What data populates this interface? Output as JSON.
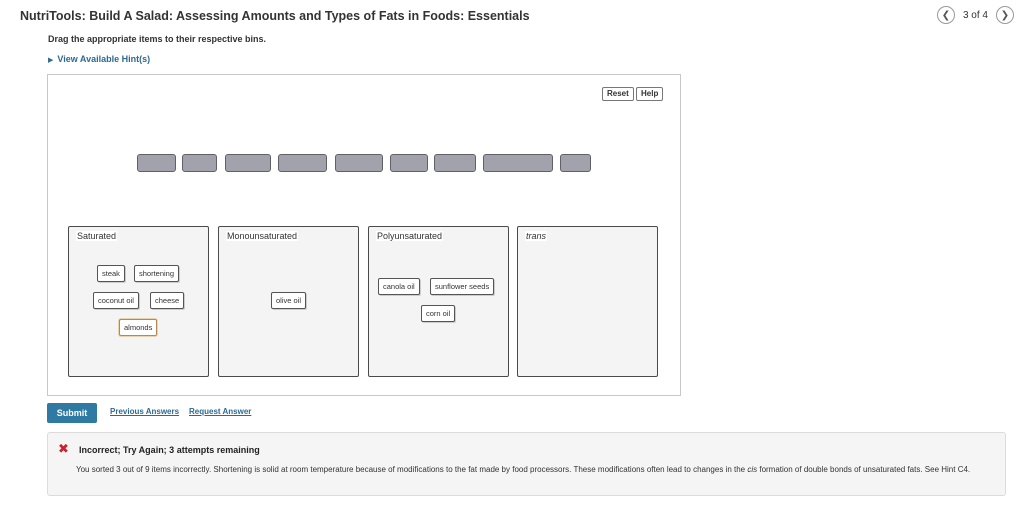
{
  "header": {
    "title": "NutriTools: Build A Salad: Assessing Amounts and Types of Fats in Foods: Essentials",
    "pager_text": "3 of 4",
    "prev_icon": "chevron-left-icon",
    "next_icon": "chevron-right-icon"
  },
  "instructions": "Drag the appropriate items to their respective bins.",
  "hint_link": "View Available Hint(s)",
  "workspace": {
    "reset_label": "Reset",
    "help_label": "Help",
    "empty_slot_count": 9,
    "bins": [
      {
        "label": "Saturated",
        "items": [
          "steak",
          "shortening",
          "coconut oil",
          "cheese",
          "almonds"
        ]
      },
      {
        "label": "Monounsaturated",
        "items": [
          "olive oil"
        ]
      },
      {
        "label": "Polyunsaturated",
        "items": [
          "canola oil",
          "sunflower seeds",
          "corn oil"
        ]
      },
      {
        "label": "trans",
        "items": []
      }
    ]
  },
  "actions": {
    "submit_label": "Submit",
    "previous_answers": "Previous Answers",
    "request_answer": "Request Answer"
  },
  "feedback": {
    "icon": "x-mark-icon",
    "icon_color": "#d0202a",
    "title": "Incorrect; Try Again; 3 attempts remaining",
    "body_part1": "You sorted 3 out of 9 items incorrectly. Shortening is solid at room temperature because of modifications to the fat made by food processors. These modifications often lead to changes in the ",
    "body_italic": "cis",
    "body_part2": " formation of double bonds of unsaturated fats. See Hint C4."
  },
  "colors": {
    "accent": "#2f7aa3",
    "link": "#2c6a93",
    "slot_fill": "#a2a2ad"
  }
}
